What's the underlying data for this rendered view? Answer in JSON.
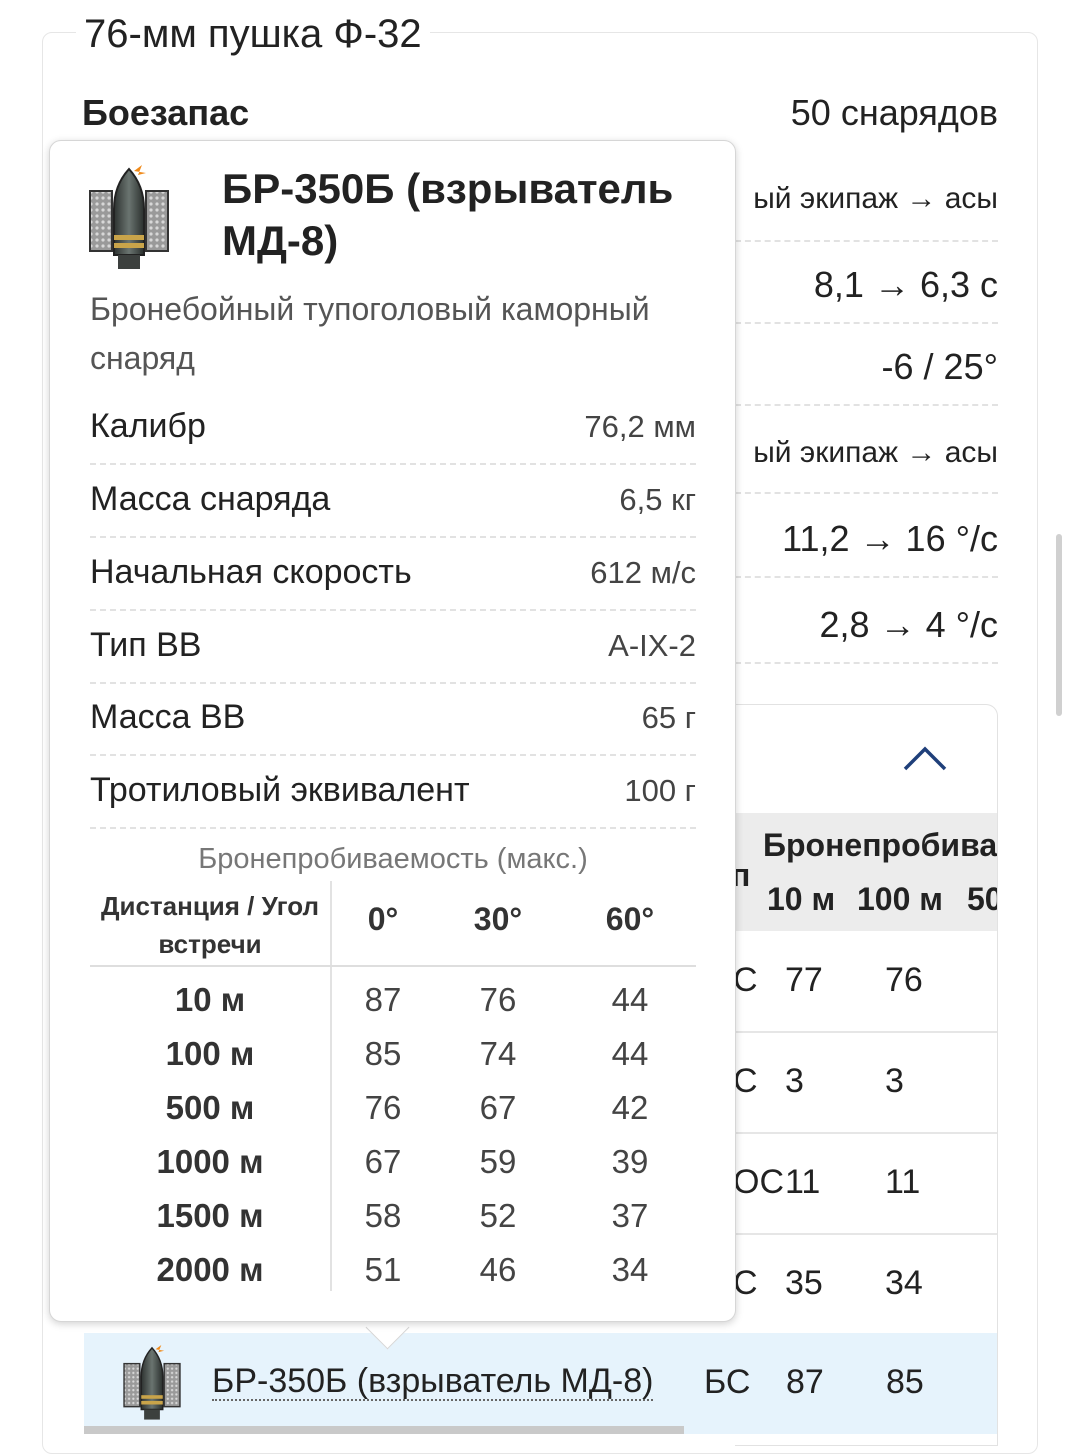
{
  "gun_title": "76-мм пушка Ф-32",
  "ammo": {
    "label": "Боезапас",
    "value": "50 снарядов"
  },
  "background_rows": [
    {
      "text": "ый экипаж → асы",
      "small": true
    },
    {
      "text": "8,1 → 6,3 с",
      "small": false
    },
    {
      "text": "-6 / 25°",
      "small": false
    },
    {
      "text": "ый экипаж → асы",
      "small": true
    },
    {
      "text": "11,2 → 16 °/с",
      "small": false
    },
    {
      "text": "2,8 → 4 °/с",
      "small": false
    }
  ],
  "compare_table": {
    "header_title": "Бронепробива",
    "header_type": "п",
    "columns": [
      "10 м",
      "100 м",
      "50"
    ],
    "rows": [
      {
        "type": "С",
        "v10": "77",
        "v100": "76"
      },
      {
        "type": "С",
        "v10": "3",
        "v100": "3"
      },
      {
        "type": "ОС",
        "v10": "11",
        "v100": "11"
      },
      {
        "type": "С",
        "v10": "35",
        "v100": "34"
      }
    ],
    "selected": {
      "name": "БР-350Б (взрыватель МД-8)",
      "type": "БС",
      "v10": "87",
      "v100": "85"
    }
  },
  "popup": {
    "title": "БР-350Б (взрыватель МД-8)",
    "description": "Бронебойный тупоголовый каморный снаряд",
    "properties": [
      {
        "key": "Калибр",
        "value": "76,2 мм"
      },
      {
        "key": "Масса снаряда",
        "value": "6,5 кг"
      },
      {
        "key": "Начальная скорость",
        "value": "612 м/с"
      },
      {
        "key": "Тип ВВ",
        "value": "A-IX-2"
      },
      {
        "key": "Масса ВВ",
        "value": "65 г"
      },
      {
        "key": "Тротиловый эквивалент",
        "value": "100 г"
      }
    ],
    "penetration": {
      "title": "Бронепробиваемость (макс.)",
      "corner_label": "Дистанция / Угол встречи",
      "angles": [
        "0°",
        "30°",
        "60°"
      ],
      "rows": [
        {
          "distance": "10 м",
          "values": [
            "87",
            "76",
            "44"
          ]
        },
        {
          "distance": "100 м",
          "values": [
            "85",
            "74",
            "44"
          ]
        },
        {
          "distance": "500 м",
          "values": [
            "76",
            "67",
            "42"
          ]
        },
        {
          "distance": "1000 м",
          "values": [
            "67",
            "59",
            "39"
          ]
        },
        {
          "distance": "1500 м",
          "values": [
            "58",
            "52",
            "37"
          ]
        },
        {
          "distance": "2000 м",
          "values": [
            "51",
            "46",
            "34"
          ]
        }
      ]
    }
  },
  "icons": {
    "shell": "shell-icon",
    "collapse": "chevron-up-icon"
  }
}
